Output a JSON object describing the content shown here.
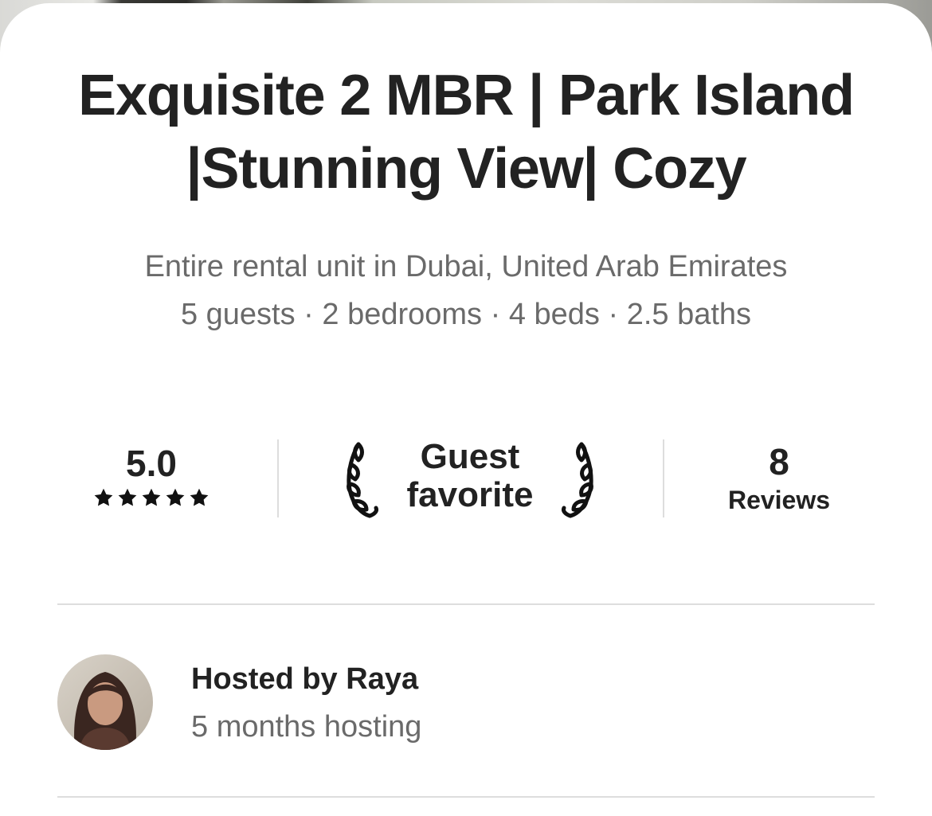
{
  "listing": {
    "title": "Exquisite 2 MBR | Park Island |Stunning View| Cozy",
    "type_location": "Entire rental unit in Dubai, United Arab Emirates",
    "capacity": "5 guests · 2 bedrooms · 4 beds · 2.5 baths"
  },
  "stats": {
    "rating": "5.0",
    "stars": 5,
    "badge_line1": "Guest",
    "badge_line2": "favorite",
    "reviews_count": "8",
    "reviews_label": "Reviews"
  },
  "host": {
    "name_line": "Hosted by Raya",
    "duration": "5 months hosting"
  },
  "icons": {
    "star": "star-icon",
    "laurel": "laurel-icon",
    "avatar": "host-avatar-photo"
  },
  "colors": {
    "text_primary": "#222222",
    "text_secondary": "#6a6a6a",
    "divider": "#dddddd"
  }
}
